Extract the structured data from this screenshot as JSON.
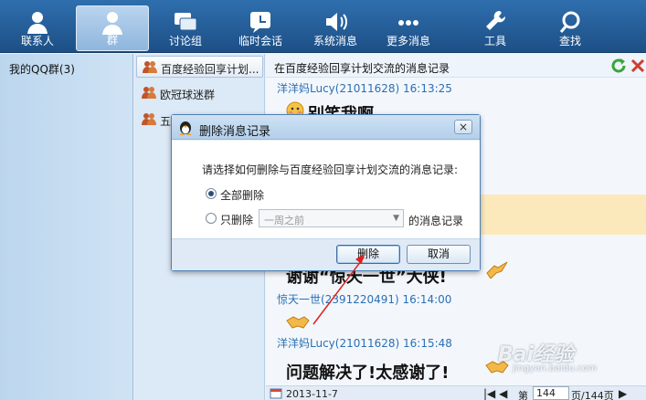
{
  "toolbar": {
    "items": [
      {
        "label": "联系人",
        "icon": "contacts-icon"
      },
      {
        "label": "群",
        "icon": "group-icon"
      },
      {
        "label": "讨论组",
        "icon": "discussion-icon"
      },
      {
        "label": "临时会话",
        "icon": "temp-session-icon"
      },
      {
        "label": "系统消息",
        "icon": "system-message-icon"
      },
      {
        "label": "更多消息",
        "icon": "more-messages-icon"
      },
      {
        "label": "工具",
        "icon": "tools-icon"
      },
      {
        "label": "查找",
        "icon": "search-icon"
      }
    ],
    "active_index": 1
  },
  "left_panel": {
    "title": "我的QQ群(3)"
  },
  "group_list": {
    "items": [
      {
        "label": "百度经验回享计划..."
      },
      {
        "label": "欧冠球迷群"
      },
      {
        "label": "五"
      }
    ],
    "selected_index": 0
  },
  "chat": {
    "title": "在百度经验回享计划交流的消息记录",
    "messages": [
      {
        "sender": "洋洋妈Lucy(21011628) 16:13:25",
        "text": "别笑我啊"
      },
      {
        "text": "谢谢“惊天一世”大侠!"
      },
      {
        "sender": "惊天一世(2391220491) 16:14:00",
        "text": ""
      },
      {
        "sender": "洋洋妈Lucy(21011628) 16:15:48",
        "text": "问题解决了!太感谢了!"
      }
    ],
    "footer": {
      "date": "2013-11-7",
      "page_prefix": "第",
      "page_value": "144",
      "page_suffix": "页/144页"
    }
  },
  "dialog": {
    "title": "删除消息记录",
    "close_label": "×",
    "prompt": "请选择如何删除与百度经验回享计划交流的消息记录:",
    "option_all": "全部删除",
    "option_partial": "只删除",
    "range_value": "一周之前",
    "range_suffix": "的消息记录",
    "delete_label": "删除",
    "cancel_label": "取消",
    "selected_option": "all"
  },
  "watermark": {
    "text": "Bai经验",
    "sub": "jingyan.baidu.com"
  },
  "colors": {
    "toolbar": "#2a63a0",
    "accent": "#2b6fb4",
    "annotation": "#e0201c"
  }
}
